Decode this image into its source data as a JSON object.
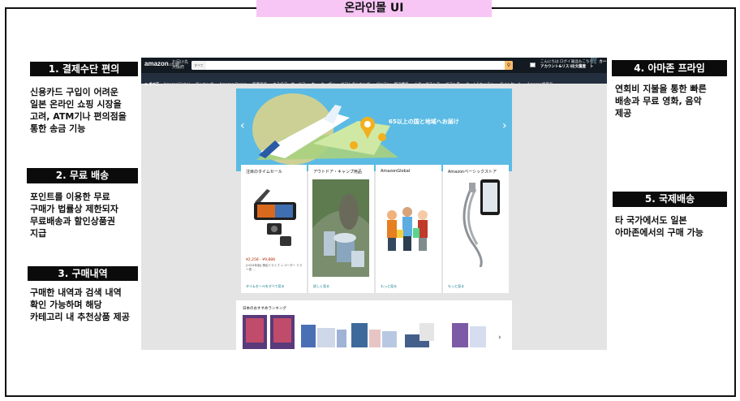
{
  "page_title": "온라인몰 UI",
  "labels": [
    {
      "title": "1. 결제수단 편의",
      "desc": [
        "신용카드 구입이 어려운",
        "일본 온라인 쇼핑 시장을",
        "고려, ATM기나 편의점을",
        "통한 송금 기능"
      ]
    },
    {
      "title": "2. 무료 배송",
      "desc": [
        "포인트를 이용한 무료",
        "구매가 법률상 제한되자",
        "무료배송과 할인상품권",
        "지급"
      ]
    },
    {
      "title": "3. 구매내역",
      "desc": [
        "구매한 내역과 검색 내역",
        "확인 가능하며 해당",
        "카테고리 내 추천상품 제공"
      ]
    },
    {
      "title": "4. 아마존 프라임",
      "desc": [
        "연회비 지불을 통한 빠른",
        "배송과 무료 영화, 음악",
        "제공"
      ]
    },
    {
      "title": "5. 국제배송",
      "desc": [
        "타 국가에서도 일본",
        "아마존에서의 구매 가능"
      ]
    }
  ],
  "screenshot": {
    "logo": "amazon",
    "logo_suffix": ".co.jp",
    "deliver_to": [
      "お届け先",
      "大阪府"
    ],
    "search_category": "すべて",
    "search_icon": "magnifier-icon",
    "nav_right": [
      {
        "l1": "こんにちは ログイン",
        "l2": "アカウント&リスト"
      },
      {
        "l1": "返品もこちら",
        "l2": "注文履歴"
      },
      {
        "l1": "",
        "l2": "カート"
      }
    ],
    "nav_menu": "≡ すべて",
    "nav_links": [
      "AmazonGlobal",
      "ランキング",
      "Amazon Basics",
      "新着商品",
      "カスタマーサービス",
      "本",
      "クーポン",
      "ギフトランキング",
      "パソコン・周辺機器",
      "ドラッグストア",
      "ギフト券",
      "ホーム&キッチン",
      "タイムセール",
      "Amazon代買品"
    ],
    "hero_text": "65以上の国と地域へお届け",
    "hero_left_arrow": "‹",
    "hero_right_arrow": "›",
    "cards": [
      {
        "title": "注目のタイムセール",
        "price": "¥2,258 - ¥9,888",
        "price_note": "[2024年版] 滑走ドライブ レコーダー ミラー型 ...",
        "link": "タイムセールをすべて見る"
      },
      {
        "title": "アウトドア・キャンプ用品",
        "link": "詳しく見る"
      },
      {
        "title": "AmazonGlobal",
        "link": "もっと見る"
      },
      {
        "title": "Amazonベーシックストア",
        "link": "もっと見る"
      }
    ],
    "recommend_title": "日本のおすすめランキング",
    "recommend_arrow": "›"
  }
}
